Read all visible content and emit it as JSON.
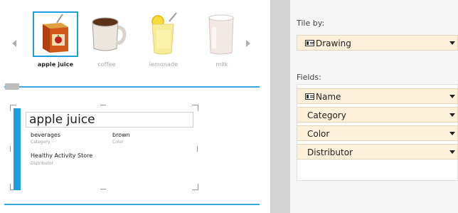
{
  "gallery": {
    "items": [
      {
        "label": "apple juice",
        "icon": "juice-box-icon",
        "selected": true
      },
      {
        "label": "coffee",
        "icon": "coffee-cup-icon",
        "selected": false
      },
      {
        "label": "lemonade",
        "icon": "lemonade-glass-icon",
        "selected": false
      },
      {
        "label": "milk",
        "icon": "milk-glass-icon",
        "selected": false
      }
    ]
  },
  "form": {
    "name": "apple juice",
    "category_value": "beverages",
    "category_label": "Category",
    "color_value": "brown",
    "color_label": "Color",
    "distributor_value": "Healthy Activity Store",
    "distributor_label": "Distributor"
  },
  "panel": {
    "tile_by_label": "Tile by:",
    "tile_by_value": "Drawing",
    "fields_label": "Fields:",
    "fields": [
      {
        "label": "Name",
        "icon": true
      },
      {
        "label": "Category",
        "icon": false
      },
      {
        "label": "Color",
        "icon": false
      },
      {
        "label": "Distributor",
        "icon": false
      }
    ]
  },
  "colors": {
    "accent": "#1ea0dc",
    "dropdown_bg": "#fdf1dc"
  }
}
